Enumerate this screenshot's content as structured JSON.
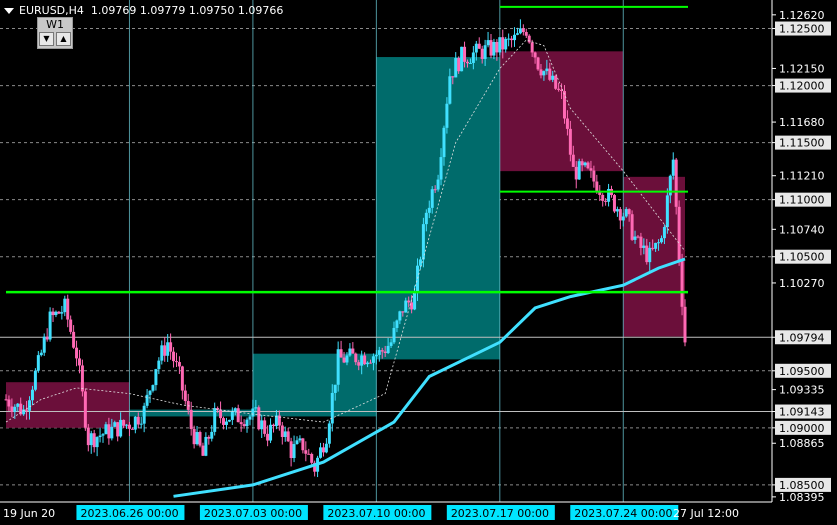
{
  "header": {
    "symbol": "EURUSD,H4",
    "ohlc": "1.09769 1.09779 1.09750 1.09766"
  },
  "timeframe": {
    "label": "W1",
    "down_icon": "triangle-down-icon",
    "up_icon": "triangle-up-icon"
  },
  "colors": {
    "background": "#000000",
    "bull": "#40e0ff",
    "bear": "#ff69b4",
    "ma": "#40e0ff",
    "green_line": "#00ff00",
    "teal_zone": "#006b6b",
    "maroon_zone": "#6b0f3a",
    "label_bg": "#00e5ff"
  },
  "chart_data": {
    "type": "candlestick",
    "symbol": "EURUSD",
    "timeframe": "H4",
    "ylim": [
      1.0835,
      1.1275
    ],
    "price_labels": [
      {
        "v": 1.1262,
        "t": "1.12620",
        "boxed": false
      },
      {
        "v": 1.125,
        "t": "1.12500",
        "boxed": true
      },
      {
        "v": 1.1215,
        "t": "1.12150",
        "boxed": false
      },
      {
        "v": 1.12,
        "t": "1.12000",
        "boxed": true
      },
      {
        "v": 1.1168,
        "t": "1.11680",
        "boxed": false
      },
      {
        "v": 1.115,
        "t": "1.11500",
        "boxed": true
      },
      {
        "v": 1.1121,
        "t": "1.11210",
        "boxed": false
      },
      {
        "v": 1.11,
        "t": "1.11000",
        "boxed": true
      },
      {
        "v": 1.1074,
        "t": "1.10740",
        "boxed": false
      },
      {
        "v": 1.105,
        "t": "1.10500",
        "boxed": true
      },
      {
        "v": 1.1027,
        "t": "1.10270",
        "boxed": false
      },
      {
        "v": 1.09794,
        "t": "1.09794",
        "boxed": true
      },
      {
        "v": 1.095,
        "t": "1.09500",
        "boxed": true
      },
      {
        "v": 1.09335,
        "t": "1.09335",
        "boxed": false
      },
      {
        "v": 1.09143,
        "t": "1.09143",
        "boxed": true
      },
      {
        "v": 1.09,
        "t": "1.09000",
        "boxed": true
      },
      {
        "v": 1.08865,
        "t": "1.08865",
        "boxed": false
      },
      {
        "v": 1.085,
        "t": "1.08500",
        "boxed": true
      },
      {
        "v": 1.08395,
        "t": "1.08395",
        "boxed": false
      }
    ],
    "dashed_levels": [
      1.125,
      1.12,
      1.115,
      1.11,
      1.105,
      1.095,
      1.09,
      1.085
    ],
    "solid_levels": [
      1.09794,
      1.09143
    ],
    "green_levels": [
      {
        "price": 1.1269,
        "from": "2023-07-17 00:00",
        "to": "2023-07-27 12:00"
      },
      {
        "price": 1.1107,
        "from": "2023-07-17 00:00",
        "to": "2023-07-27 12:00"
      },
      {
        "price": 1.1019,
        "from": "2023-06-19 00:00",
        "to": "2023-07-27 12:00"
      }
    ],
    "zones": [
      {
        "color": "maroon",
        "from": "2023-06-19 00:00",
        "to": "2023-06-26 00:00",
        "high": 1.094,
        "low": 1.09
      },
      {
        "color": "teal",
        "from": "2023-06-26 00:00",
        "to": "2023-07-03 00:00",
        "high": 1.0916,
        "low": 1.091
      },
      {
        "color": "teal",
        "from": "2023-07-03 00:00",
        "to": "2023-07-10 00:00",
        "high": 1.0965,
        "low": 1.091
      },
      {
        "color": "teal",
        "from": "2023-07-10 00:00",
        "to": "2023-07-17 00:00",
        "high": 1.1225,
        "low": 1.096
      },
      {
        "color": "maroon",
        "from": "2023-07-17 00:00",
        "to": "2023-07-24 00:00",
        "high": 1.123,
        "low": 1.1125
      },
      {
        "color": "maroon",
        "from": "2023-07-24 00:00",
        "to": "2023-07-27 12:00",
        "high": 1.112,
        "low": 1.098
      }
    ],
    "week_separators": [
      "2023-06-26 00:00",
      "2023-07-03 00:00",
      "2023-07-10 00:00",
      "2023-07-17 00:00",
      "2023-07-24 00:00"
    ],
    "x_labels": [
      {
        "t": "19 Jun 20",
        "at": "2023-06-19 00:00",
        "boxed": false
      },
      {
        "t": "2023.06.26 00:00",
        "at": "2023-06-26 00:00",
        "boxed": true
      },
      {
        "t": "2023.07.03 00:00",
        "at": "2023-07-03 00:00",
        "boxed": true
      },
      {
        "t": "2023.07.10 00:00",
        "at": "2023-07-10 00:00",
        "boxed": true
      },
      {
        "t": "2023.07.17 00:00",
        "at": "2023-07-17 00:00",
        "boxed": true
      },
      {
        "t": "2023.07.24 00:00",
        "at": "2023-07-24 00:00",
        "boxed": true
      },
      {
        "t": "27 Jul 12:00",
        "at": "2023-07-27 12:00",
        "boxed": false
      }
    ],
    "close_path": [
      [
        "2023-06-19 00:00",
        1.0925
      ],
      [
        "2023-06-20 00:00",
        1.0915
      ],
      [
        "2023-06-20 20:00",
        1.0955
      ],
      [
        "2023-06-21 12:00",
        1.0995
      ],
      [
        "2023-06-22 08:00",
        1.1005
      ],
      [
        "2023-06-23 00:00",
        1.0965
      ],
      [
        "2023-06-23 16:00",
        1.089
      ],
      [
        "2023-06-26 04:00",
        1.0905
      ],
      [
        "2023-06-26 20:00",
        1.0915
      ],
      [
        "2023-06-27 12:00",
        1.0955
      ],
      [
        "2023-06-28 04:00",
        1.0975
      ],
      [
        "2023-06-28 20:00",
        1.0945
      ],
      [
        "2023-06-29 12:00",
        1.09
      ],
      [
        "2023-06-30 04:00",
        1.0875
      ],
      [
        "2023-06-30 20:00",
        1.091
      ],
      [
        "2023-07-03 04:00",
        1.091
      ],
      [
        "2023-07-03 20:00",
        1.0895
      ],
      [
        "2023-07-04 12:00",
        1.0905
      ],
      [
        "2023-07-05 04:00",
        1.088
      ],
      [
        "2023-07-05 20:00",
        1.0885
      ],
      [
        "2023-07-06 12:00",
        1.0865
      ],
      [
        "2023-07-07 04:00",
        1.0895
      ],
      [
        "2023-07-07 20:00",
        1.096
      ],
      [
        "2023-07-10 04:00",
        1.0965
      ],
      [
        "2023-07-10 20:00",
        1.0975
      ],
      [
        "2023-07-11 12:00",
        1.1005
      ],
      [
        "2023-07-12 04:00",
        1.1015
      ],
      [
        "2023-07-12 20:00",
        1.109
      ],
      [
        "2023-07-13 12:00",
        1.1125
      ],
      [
        "2023-07-14 04:00",
        1.121
      ],
      [
        "2023-07-14 20:00",
        1.1225
      ],
      [
        "2023-07-17 04:00",
        1.1235
      ],
      [
        "2023-07-17 20:00",
        1.124
      ],
      [
        "2023-07-18 12:00",
        1.125
      ],
      [
        "2023-07-19 04:00",
        1.122
      ],
      [
        "2023-07-19 20:00",
        1.1205
      ],
      [
        "2023-07-20 12:00",
        1.119
      ],
      [
        "2023-07-21 04:00",
        1.1125
      ],
      [
        "2023-07-21 20:00",
        1.1125
      ],
      [
        "2023-07-24 04:00",
        1.1085
      ],
      [
        "2023-07-24 20:00",
        1.106
      ],
      [
        "2023-07-25 12:00",
        1.105
      ],
      [
        "2023-07-26 04:00",
        1.1065
      ],
      [
        "2023-07-26 20:00",
        1.1135
      ],
      [
        "2023-07-27 04:00",
        1.105
      ],
      [
        "2023-07-27 12:00",
        1.09766
      ]
    ],
    "ma_slow": [
      [
        "2023-06-28 12:00",
        1.084
      ],
      [
        "2023-07-03 00:00",
        1.085
      ],
      [
        "2023-07-07 00:00",
        1.087
      ],
      [
        "2023-07-11 00:00",
        1.0905
      ],
      [
        "2023-07-13 00:00",
        1.0945
      ],
      [
        "2023-07-17 00:00",
        1.0975
      ],
      [
        "2023-07-19 00:00",
        1.1005
      ],
      [
        "2023-07-21 00:00",
        1.1015
      ],
      [
        "2023-07-24 00:00",
        1.1025
      ],
      [
        "2023-07-26 00:00",
        1.104
      ],
      [
        "2023-07-27 12:00",
        1.1048
      ]
    ],
    "ma_fast": [
      [
        "2023-06-19 00:00",
        1.0905
      ],
      [
        "2023-06-21 00:00",
        1.0925
      ],
      [
        "2023-06-23 00:00",
        1.0935
      ],
      [
        "2023-06-26 00:00",
        1.093
      ],
      [
        "2023-06-29 00:00",
        1.092
      ],
      [
        "2023-07-03 00:00",
        1.0912
      ],
      [
        "2023-07-07 00:00",
        1.0905
      ],
      [
        "2023-07-10 12:00",
        1.093
      ],
      [
        "2023-07-12 12:00",
        1.104
      ],
      [
        "2023-07-14 12:00",
        1.115
      ],
      [
        "2023-07-17 00:00",
        1.1215
      ],
      [
        "2023-07-18 12:00",
        1.124
      ],
      [
        "2023-07-19 12:00",
        1.1235
      ],
      [
        "2023-07-21 00:00",
        1.118
      ],
      [
        "2023-07-24 00:00",
        1.1125
      ],
      [
        "2023-07-26 00:00",
        1.1085
      ],
      [
        "2023-07-27 12:00",
        1.1055
      ]
    ]
  }
}
